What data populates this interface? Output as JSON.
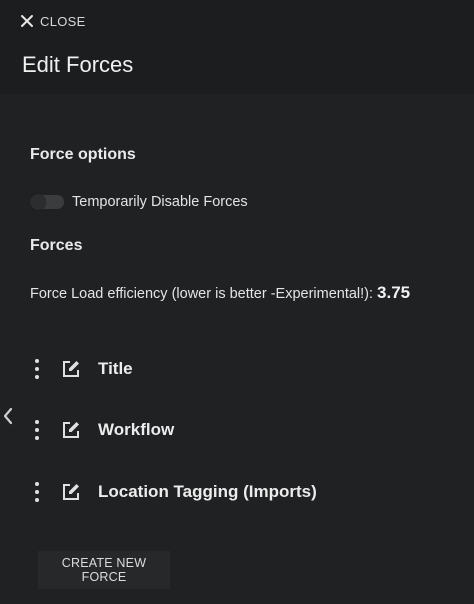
{
  "header": {
    "close_label": "CLOSE",
    "close_icon": "close-icon",
    "title": "Edit Forces"
  },
  "force_options": {
    "heading": "Force options",
    "toggle_label": "Temporarily Disable Forces",
    "toggle_on": false
  },
  "forces": {
    "heading": "Forces",
    "efficiency_label": "Force Load efficiency (lower is better -Experimental!):",
    "efficiency_value": "3.75",
    "items": [
      {
        "title": "Title",
        "menu_icon": "more-vertical-icon",
        "edit_icon": "edit-icon"
      },
      {
        "title": "Workflow",
        "menu_icon": "more-vertical-icon",
        "edit_icon": "edit-icon"
      },
      {
        "title": "Location Tagging (Imports)",
        "menu_icon": "more-vertical-icon",
        "edit_icon": "edit-icon"
      }
    ],
    "create_label": "CREATE NEW FORCE"
  },
  "side_nav": {
    "icon": "chevron-left-icon"
  },
  "colors": {
    "header_bg": "#1b1d1f",
    "body_bg": "#1f2123",
    "button_bg": "#26282a",
    "text": "#e6e6e6"
  }
}
